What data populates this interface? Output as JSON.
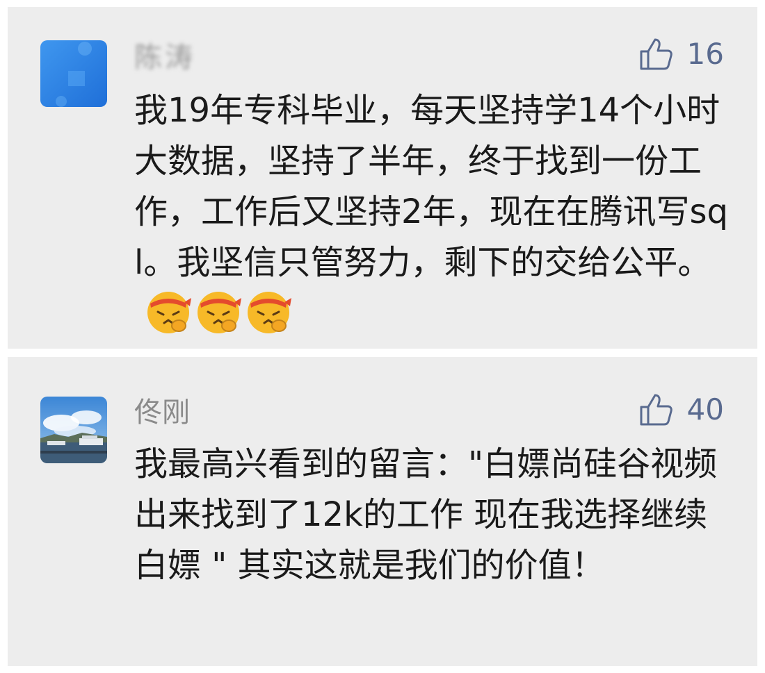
{
  "comments": [
    {
      "username": "陈涛",
      "likes": "16",
      "text": "我19年专科毕业，每天坚持学14个小时大数据，坚持了半年，终于找到一份工作，工作后又坚持2年，现在在腾讯写sql。我坚信只管努力，剩下的交给公平。",
      "emoji": [
        "determined-face-emoji",
        "determined-face-emoji",
        "determined-face-emoji"
      ]
    },
    {
      "username": "佟刚",
      "likes": "40",
      "text": "我最高兴看到的留言：\"白嫖尚硅谷视频出来找到了12k的工作 现在我选择继续白嫖 \" 其实这就是我们的价值！"
    }
  ],
  "colors": {
    "like": "#596a8f",
    "username": "#8a8a8a",
    "text": "#1a1a1a",
    "card_bg": "#ededed",
    "avatar_1": "#2e86ea"
  },
  "icons": {
    "like": "thumbs-up-icon"
  }
}
